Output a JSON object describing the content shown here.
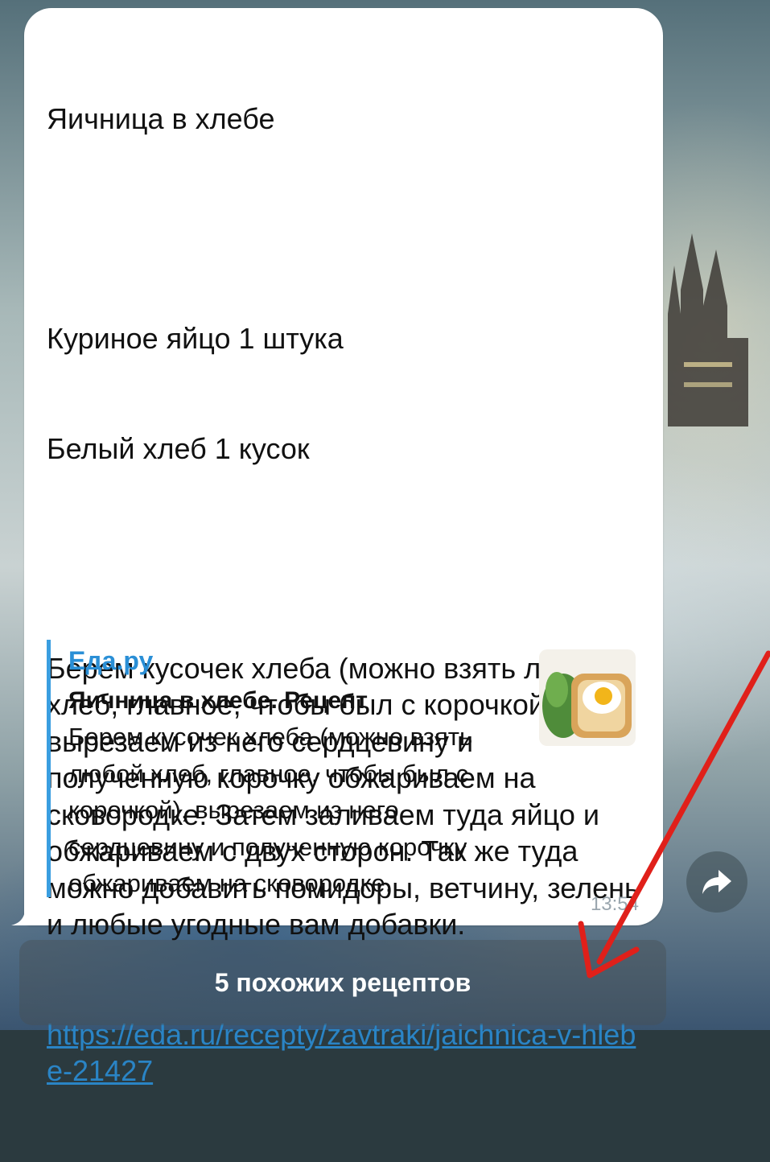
{
  "message": {
    "title": "Яичница в хлебе",
    "ingredients": [
      "Куриное яйцо 1 штука",
      "Белый хлеб 1 кусок"
    ],
    "body": "Берем кусочек хлеба (можно взять любой хлеб, главное, чтобы был с корочкой), вырезаем из него сердцевину и полученную корочку обжариваем на сковородке. Затем заливаем туда яйцо и обжариваем с двух сторон. Так же туда можно добавить помидоры, ветчину, зелень и любые угодные вам добавки.",
    "link": "https://eda.ru/recepty/zavtraki/jaichnica-v-hlebe-21427",
    "time": "13:54"
  },
  "preview": {
    "site": "Еда.ру",
    "title": "Яичница в хлебе. Рецепт",
    "description": "Берем кусочек хлеба (можно взять любой хлеб, главное, чтобы был с корочкой), вырезаем из него сердцевину и полученную корочку обжариваем на сковородке.",
    "thumbnail_icon": "fried-egg-in-bread-image"
  },
  "inline_button": {
    "label": "5 похожих рецептов"
  },
  "share_icon": "share-arrow-icon",
  "colors": {
    "link": "#2a84c5",
    "preview_accent": "#3a9ee0",
    "annotation_arrow": "#e0201a"
  }
}
